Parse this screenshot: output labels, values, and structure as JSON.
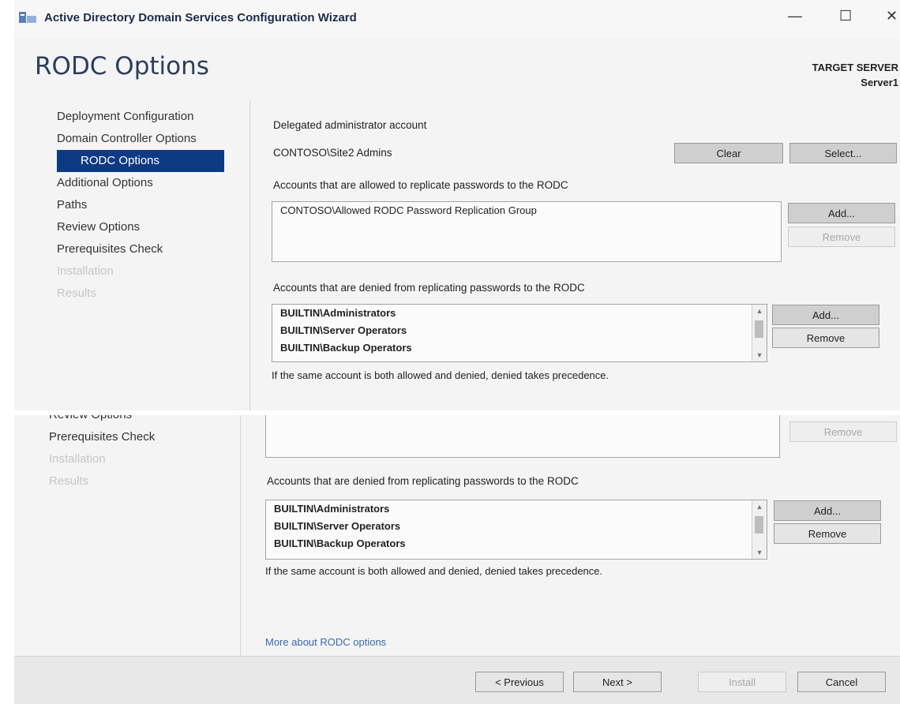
{
  "window": {
    "title": "Active Directory Domain Services Configuration Wizard",
    "minimize_glyph": "—",
    "maximize_glyph": "☐",
    "close_glyph": "✕"
  },
  "page": {
    "title": "RODC Options",
    "target_label": "TARGET SERVER",
    "target_server": "Server1"
  },
  "nav": {
    "items": [
      {
        "label": "Deployment Configuration",
        "state": "normal"
      },
      {
        "label": "Domain Controller Options",
        "state": "normal"
      },
      {
        "label": "RODC Options",
        "state": "selected"
      },
      {
        "label": "Additional Options",
        "state": "normal"
      },
      {
        "label": "Paths",
        "state": "normal"
      },
      {
        "label": "Review Options",
        "state": "normal"
      },
      {
        "label": "Prerequisites Check",
        "state": "normal"
      },
      {
        "label": "Installation",
        "state": "disabled"
      },
      {
        "label": "Results",
        "state": "disabled"
      }
    ]
  },
  "delegated": {
    "label": "Delegated administrator account",
    "value": "CONTOSO\\Site2 Admins",
    "clear_label": "Clear",
    "select_label": "Select..."
  },
  "allowed": {
    "label": "Accounts that are allowed to replicate passwords to the RODC",
    "accounts": [
      "CONTOSO\\Allowed RODC Password Replication Group"
    ],
    "add_label": "Add...",
    "remove_label": "Remove"
  },
  "denied": {
    "label": "Accounts that are denied from replicating passwords to the RODC",
    "accounts": [
      "BUILTIN\\Administrators",
      "BUILTIN\\Server Operators",
      "BUILTIN\\Backup Operators"
    ],
    "add_label": "Add...",
    "remove_label": "Remove",
    "note": "If the same account is both allowed and denied, denied takes precedence."
  },
  "more_link": "More about RODC options",
  "footer": {
    "previous_label": "< Previous",
    "next_label": "Next >",
    "install_label": "Install",
    "cancel_label": "Cancel"
  },
  "colors": {
    "nav_selected_bg": "#0e3a84",
    "title_color": "#2c3e5c",
    "link_color": "#3b67b3"
  }
}
